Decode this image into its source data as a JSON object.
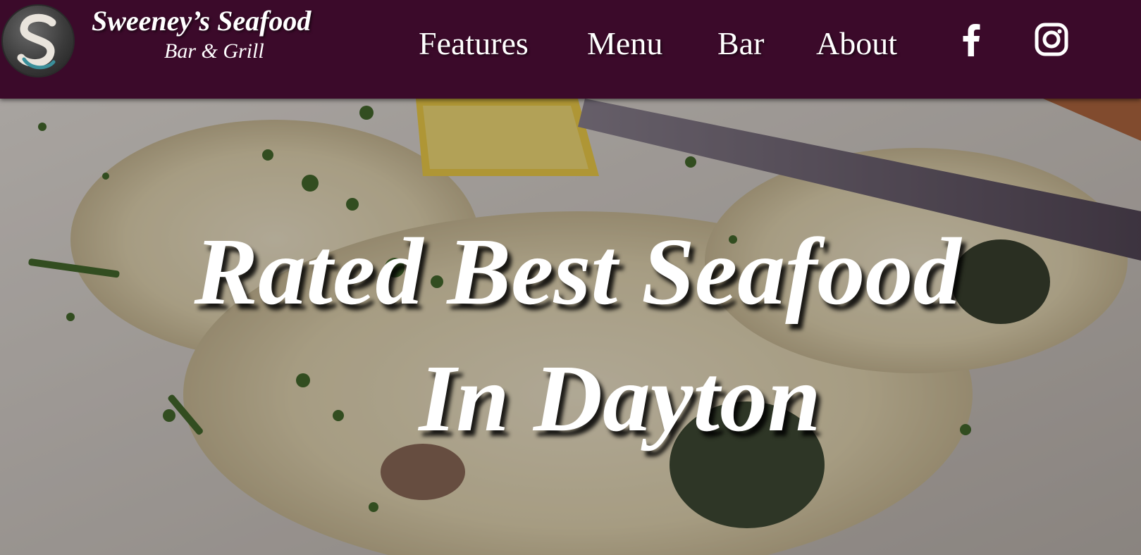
{
  "brand": {
    "name": "Sweeney’s Seafood",
    "subtitle": "Bar & Grill",
    "logo_letter": "S"
  },
  "nav": {
    "items": [
      {
        "label": "Features"
      },
      {
        "label": "Menu"
      },
      {
        "label": "Bar"
      },
      {
        "label": "About"
      }
    ],
    "social": [
      {
        "icon": "facebook-icon"
      },
      {
        "icon": "instagram-icon"
      }
    ]
  },
  "hero": {
    "line1": "Rated Best Seafood",
    "line2": "In Dayton"
  },
  "colors": {
    "header_bg": "#3b0a2a",
    "text": "#ffffff"
  }
}
